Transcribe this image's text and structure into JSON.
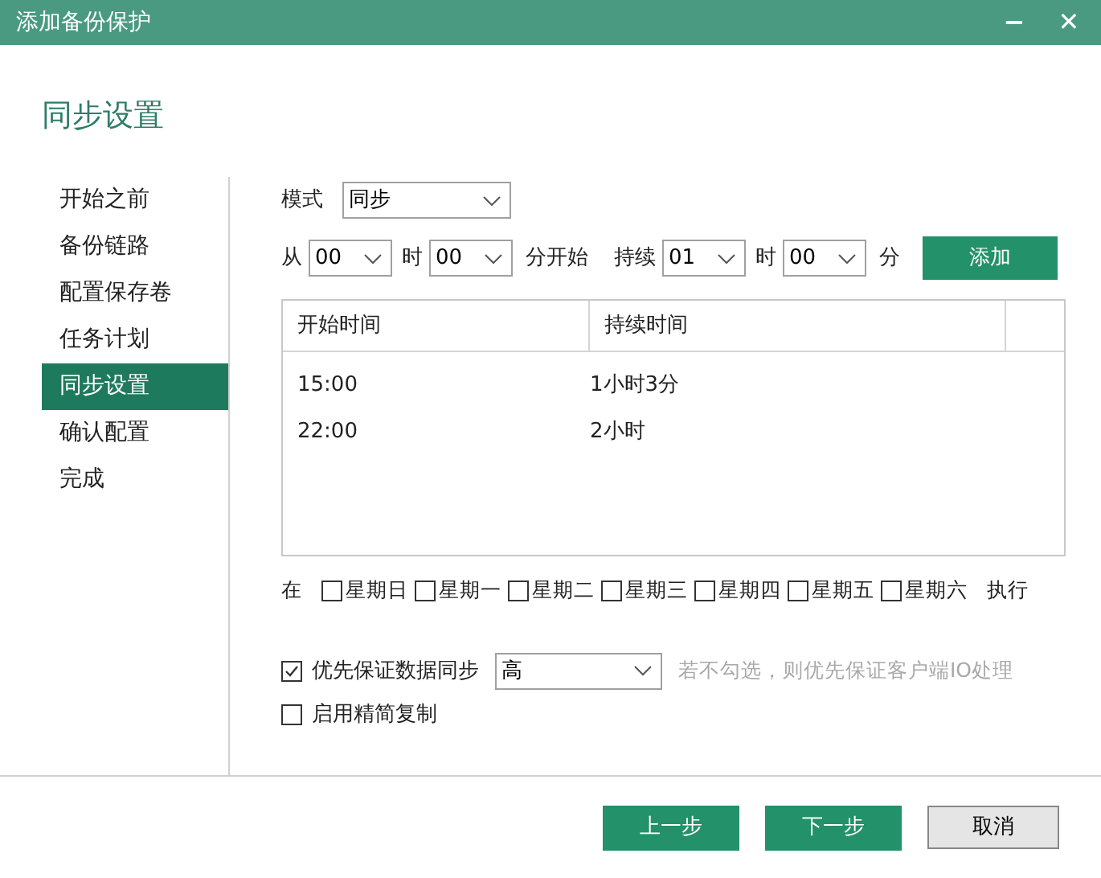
{
  "window": {
    "title": "添加备份保护",
    "minimize": "−",
    "close": "✕"
  },
  "heading": "同步设置",
  "sidebar": {
    "items": [
      {
        "label": "开始之前",
        "selected": false
      },
      {
        "label": "备份链路",
        "selected": false
      },
      {
        "label": "配置保存卷",
        "selected": false
      },
      {
        "label": "任务计划",
        "selected": false
      },
      {
        "label": "同步设置",
        "selected": true
      },
      {
        "label": "确认配置",
        "selected": false
      },
      {
        "label": "完成",
        "selected": false
      }
    ]
  },
  "mode": {
    "label": "模式",
    "value": "同步"
  },
  "schedule": {
    "from_label": "从",
    "start_hour": "00",
    "hour_label_1": "时",
    "start_minute": "00",
    "start_suffix": "分开始",
    "duration_label": "持续",
    "duration_hour": "01",
    "hour_label_2": "时",
    "duration_minute": "00",
    "minute_label": "分",
    "add_button": "添加"
  },
  "table": {
    "columns": [
      "开始时间",
      "持续时间"
    ],
    "rows": [
      [
        "15:00",
        "1小时3分"
      ],
      [
        "22:00",
        "2小时"
      ]
    ]
  },
  "weekdays": {
    "prefix": "在",
    "suffix": "执行",
    "days": [
      {
        "label": "星期日",
        "checked": false
      },
      {
        "label": "星期一",
        "checked": false
      },
      {
        "label": "星期二",
        "checked": false
      },
      {
        "label": "星期三",
        "checked": false
      },
      {
        "label": "星期四",
        "checked": false
      },
      {
        "label": "星期五",
        "checked": false
      },
      {
        "label": "星期六",
        "checked": false
      }
    ]
  },
  "priority": {
    "label": "优先保证数据同步",
    "checked": true,
    "value": "高",
    "hint": "若不勾选，则优先保证客户端IO处理"
  },
  "compact_copy": {
    "label": "启用精简复制",
    "checked": false
  },
  "buttons": {
    "back": "上一步",
    "next": "下一步",
    "cancel": "取消"
  }
}
